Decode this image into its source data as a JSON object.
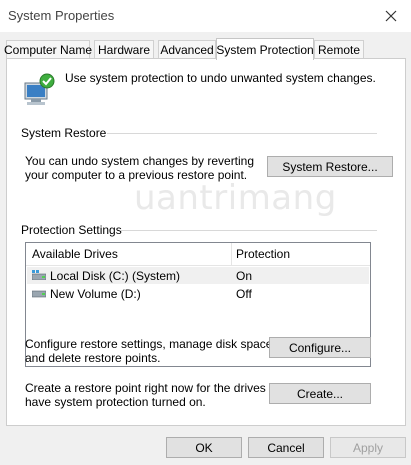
{
  "window": {
    "title": "System Properties"
  },
  "tabs": [
    {
      "label": "Computer Name"
    },
    {
      "label": "Hardware"
    },
    {
      "label": "Advanced"
    },
    {
      "label": "System Protection"
    },
    {
      "label": "Remote"
    }
  ],
  "active_tab": "System Protection",
  "intro_text": "Use system protection to undo unwanted system changes.",
  "system_restore": {
    "heading": "System Restore",
    "description_line1": "You can undo system changes by reverting",
    "description_line2": "your computer to a previous restore point.",
    "button_label": "System Restore..."
  },
  "protection_settings": {
    "heading": "Protection Settings",
    "columns": [
      "Available Drives",
      "Protection"
    ],
    "drives": [
      {
        "name": "Local Disk (C:) (System)",
        "protection": "On",
        "icon": "system-drive-icon"
      },
      {
        "name": "New Volume (D:)",
        "protection": "Off",
        "icon": "drive-icon"
      }
    ]
  },
  "configure": {
    "description_line1": "Configure restore settings, manage disk space,",
    "description_line2": "and delete restore points.",
    "button_label": "Configure..."
  },
  "create": {
    "description_line1": "Create a restore point right now for the drives that",
    "description_line2": "have system protection turned on.",
    "button_label": "Create..."
  },
  "footer": {
    "ok": "OK",
    "cancel": "Cancel",
    "apply": "Apply"
  },
  "watermark": "uantrimang"
}
